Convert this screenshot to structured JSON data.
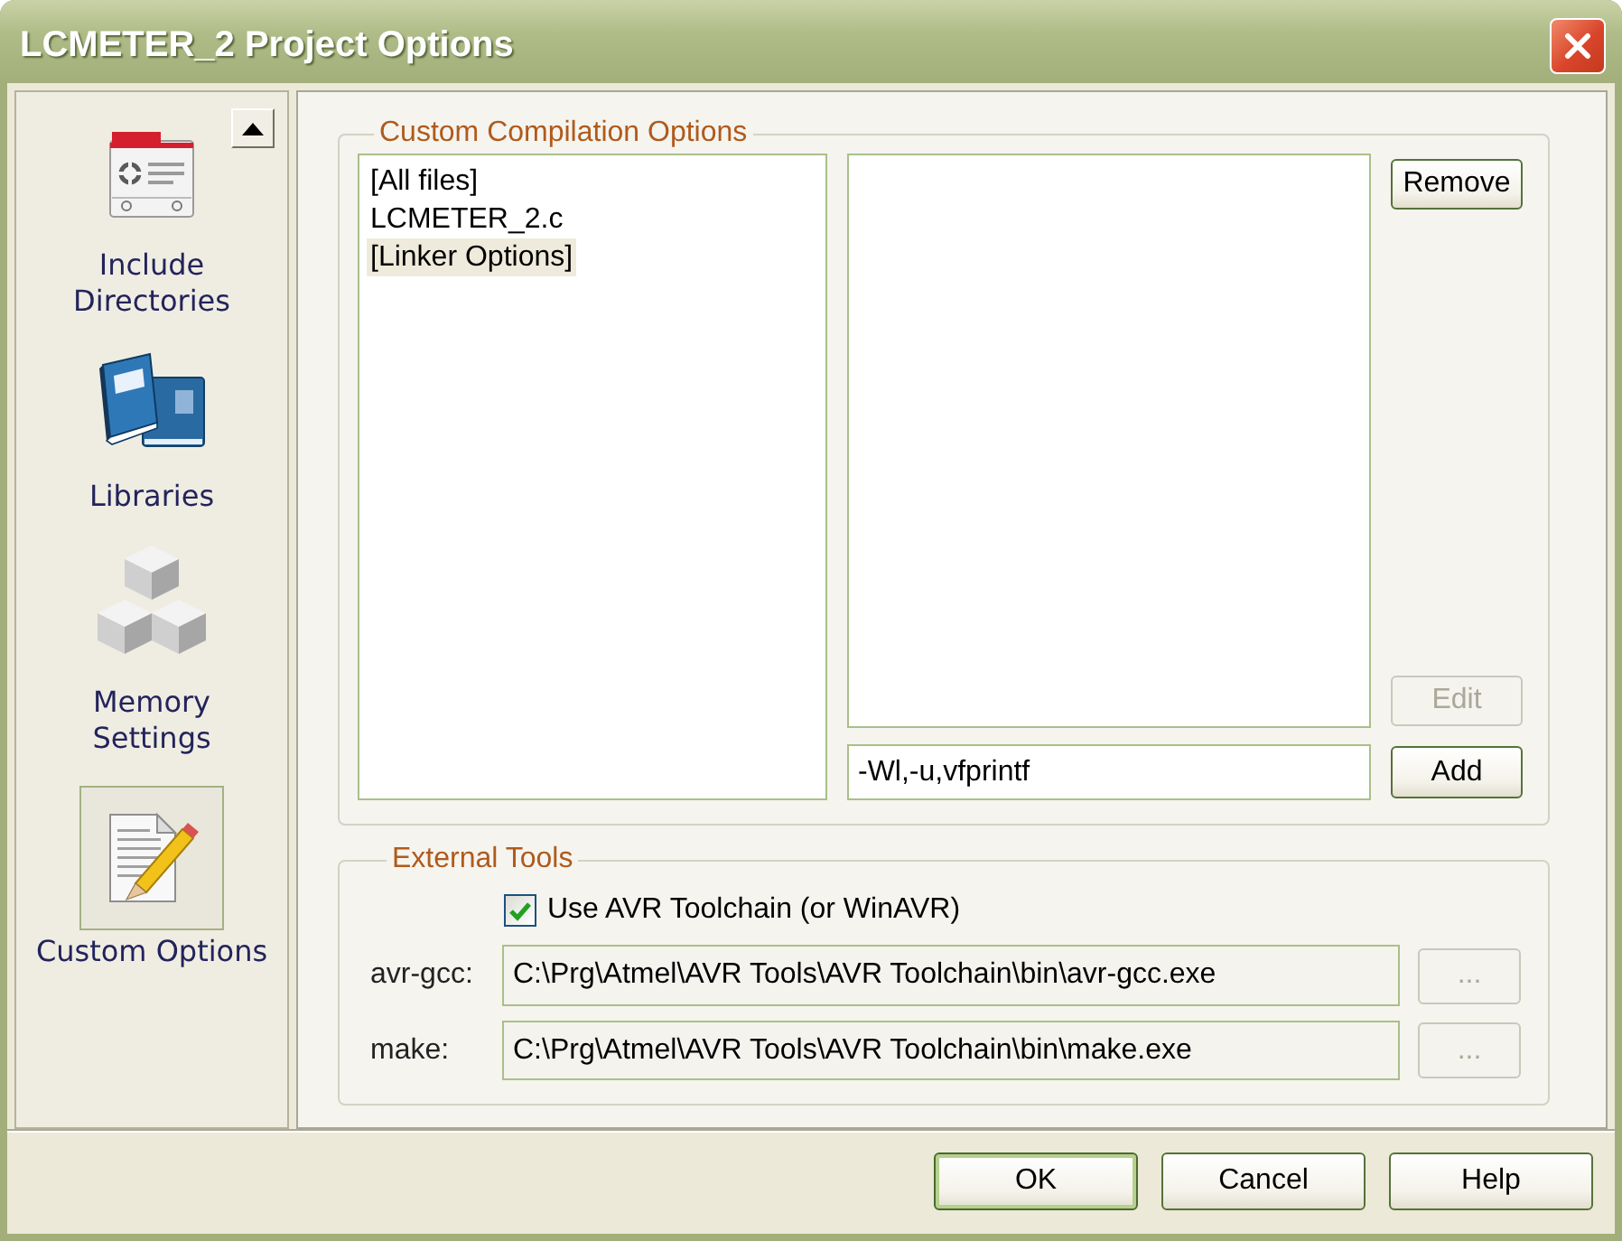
{
  "window": {
    "title": "LCMETER_2 Project Options"
  },
  "sidebar": {
    "items": [
      {
        "kind": "include",
        "label": "Include Directories",
        "selected": false
      },
      {
        "kind": "libraries",
        "label": "Libraries",
        "selected": false
      },
      {
        "kind": "memory",
        "label": "Memory Settings",
        "selected": false
      },
      {
        "kind": "custom",
        "label": "Custom Options",
        "selected": true
      }
    ]
  },
  "custom_compilation_options": {
    "title": "Custom Compilation Options",
    "files": [
      {
        "label": "[All files]",
        "selected": false
      },
      {
        "label": "LCMETER_2.c",
        "selected": false
      },
      {
        "label": "[Linker Options]",
        "selected": true
      }
    ],
    "options_input": {
      "value": "-Wl,-u,vfprintf"
    },
    "buttons": [
      {
        "label": "Remove",
        "disabled": false
      },
      {
        "label": "Edit",
        "disabled": true
      },
      {
        "label": "Add",
        "disabled": false
      }
    ]
  },
  "external_tools": {
    "title": "External Tools",
    "use_toolchain": {
      "label": "Use AVR Toolchain (or WinAVR)",
      "checked": true
    },
    "tools": [
      {
        "label": "avr-gcc:",
        "value": "C:\\Prg\\Atmel\\AVR Tools\\AVR Toolchain\\bin\\avr-gcc.exe",
        "disabled": true,
        "browse": {
          "label": "...",
          "disabled": true
        }
      },
      {
        "label": "make:",
        "value": "C:\\Prg\\Atmel\\AVR Tools\\AVR Toolchain\\bin\\make.exe",
        "disabled": true,
        "browse": {
          "label": "...",
          "disabled": true
        }
      }
    ]
  },
  "footer": {
    "buttons": [
      {
        "label": "OK",
        "default": true
      },
      {
        "label": "Cancel",
        "default": false
      },
      {
        "label": "Help",
        "default": false
      }
    ]
  }
}
